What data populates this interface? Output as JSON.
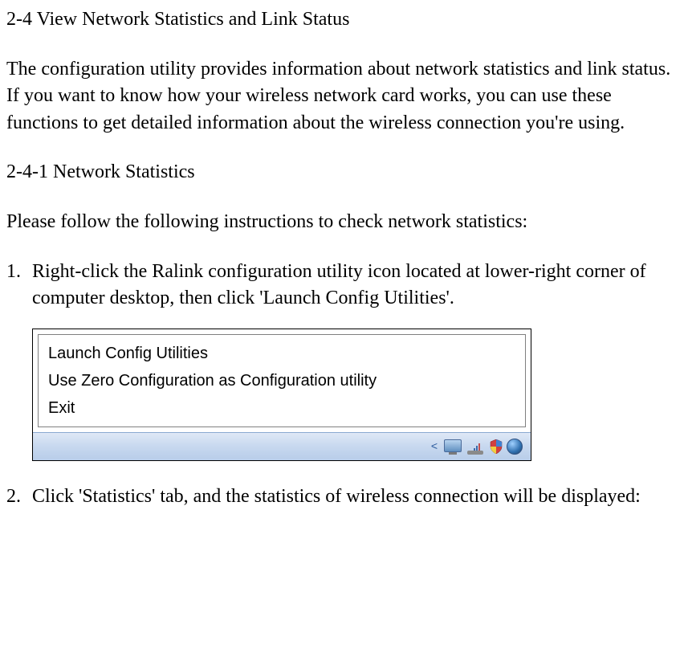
{
  "section": {
    "number": "2-4",
    "title": "View Network Statistics and Link Status"
  },
  "intro_paragraph": "The configuration utility provides information about network statistics and link status. If you want to know how your wireless network card works, you can use these functions to get detailed information about the wireless connection you're using.",
  "subsection": {
    "number": "2-4-1",
    "title": "Network Statistics"
  },
  "instructions_lead": "Please follow the following instructions to check network statistics:",
  "steps": [
    {
      "number": "1.",
      "text": "Right-click the Ralink configuration utility icon located at lower-right corner of computer desktop, then click 'Launch Config Utilities'."
    },
    {
      "number": "2.",
      "text": "Click 'Statistics' tab, and the statistics of wireless connection will be displayed:"
    }
  ],
  "context_menu": {
    "items": [
      "Launch Config Utilities",
      "Use Zero Configuration as Configuration utility",
      "Exit"
    ]
  },
  "tray": {
    "chevron": "<"
  }
}
